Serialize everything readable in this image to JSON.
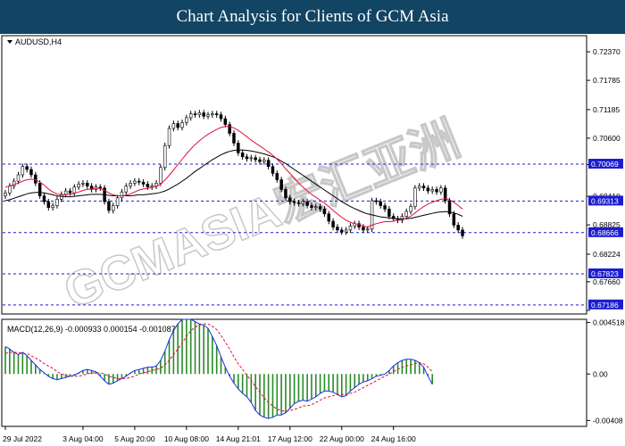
{
  "banner": {
    "title": "Chart Analysis for Clients of GCM Asia"
  },
  "chart_data": {
    "type": "candlestick",
    "symbol": "AUDUSD,H4",
    "watermark": "GCMASIA宏汇亚洲",
    "colors": {
      "bull_body": "#ffffff",
      "bear_body": "#000000",
      "wick": "#000000",
      "ma_fast": "#e0103a",
      "ma_slow": "#000000",
      "level_line": "#1c1cd0",
      "label_bg": "#1c1cd0"
    },
    "price_axis": {
      "ylim": [
        0.67,
        0.727
      ],
      "ticks": [
        0.7237,
        0.71785,
        0.71185,
        0.706,
        0.7006,
        0.6941,
        0.68825,
        0.68224,
        0.6766,
        0.67075
      ]
    },
    "levels": [
      0.70069,
      0.69313,
      0.68666,
      0.67823,
      0.67186
    ],
    "level_labels": [
      "0.70069",
      "0.69313",
      "0.68666",
      "0.67823",
      "0.67186"
    ],
    "price_ticks": [
      "0.72370",
      "0.71785",
      "0.71185",
      "0.70600",
      "0.69410",
      "0.68825",
      "0.68224",
      "0.67660"
    ],
    "close": [
      0.6948,
      0.6962,
      0.6972,
      0.6985,
      0.7002,
      0.6996,
      0.6985,
      0.6968,
      0.6942,
      0.693,
      0.6918,
      0.6922,
      0.6935,
      0.6945,
      0.6952,
      0.6948,
      0.696,
      0.6966,
      0.6968,
      0.6962,
      0.6955,
      0.696,
      0.6958,
      0.693,
      0.6912,
      0.6922,
      0.6938,
      0.695,
      0.6962,
      0.6968,
      0.6972,
      0.697,
      0.6966,
      0.696,
      0.6962,
      0.6968,
      0.7,
      0.7045,
      0.708,
      0.709,
      0.7082,
      0.7092,
      0.7102,
      0.711,
      0.7108,
      0.7112,
      0.7105,
      0.7108,
      0.711,
      0.7108,
      0.71,
      0.7088,
      0.707,
      0.705,
      0.703,
      0.7022,
      0.7018,
      0.702,
      0.7016,
      0.7012,
      0.7015,
      0.7002,
      0.6988,
      0.6975,
      0.6955,
      0.6938,
      0.693,
      0.6928,
      0.6926,
      0.693,
      0.6922,
      0.6918,
      0.692,
      0.6915,
      0.6905,
      0.689,
      0.6878,
      0.6872,
      0.6868,
      0.6872,
      0.688,
      0.6885,
      0.6878,
      0.6872,
      0.6874,
      0.6932,
      0.693,
      0.6922,
      0.6915,
      0.69,
      0.6895,
      0.6892,
      0.69,
      0.691,
      0.692,
      0.6958,
      0.6962,
      0.6958,
      0.6952,
      0.6955,
      0.695,
      0.6958,
      0.6932,
      0.6905,
      0.6882,
      0.6872,
      0.686
    ],
    "ma_fast": [
      0.696,
      0.6962,
      0.6965,
      0.6968,
      0.6972,
      0.6975,
      0.6976,
      0.6975,
      0.697,
      0.6964,
      0.6956,
      0.695,
      0.6946,
      0.6944,
      0.6944,
      0.6945,
      0.6947,
      0.695,
      0.6953,
      0.6955,
      0.6956,
      0.6957,
      0.6957,
      0.6953,
      0.6948,
      0.6944,
      0.6942,
      0.6942,
      0.6943,
      0.6946,
      0.695,
      0.6954,
      0.6956,
      0.6957,
      0.6959,
      0.6961,
      0.6966,
      0.6974,
      0.6984,
      0.6995,
      0.7006,
      0.7017,
      0.7028,
      0.7038,
      0.7047,
      0.7055,
      0.7062,
      0.7068,
      0.7073,
      0.7078,
      0.7082,
      0.7084,
      0.7084,
      0.7081,
      0.7076,
      0.707,
      0.7063,
      0.7056,
      0.705,
      0.7044,
      0.7038,
      0.7032,
      0.7025,
      0.7017,
      0.7008,
      0.6997,
      0.6988,
      0.6978,
      0.6968,
      0.696,
      0.6952,
      0.6945,
      0.6939,
      0.6933,
      0.6927,
      0.692,
      0.6912,
      0.6905,
      0.6898,
      0.6892,
      0.6888,
      0.6885,
      0.6883,
      0.688,
      0.6878,
      0.6882,
      0.6885,
      0.6887,
      0.6889,
      0.6889,
      0.689,
      0.6892,
      0.6893,
      0.6896,
      0.69,
      0.6907,
      0.6914,
      0.692,
      0.6925,
      0.6929,
      0.6932,
      0.6935,
      0.6936,
      0.6934,
      0.6929,
      0.6922,
      0.6915
    ],
    "ma_slow": [
      0.6932,
      0.6934,
      0.6937,
      0.694,
      0.6943,
      0.6946,
      0.6948,
      0.6949,
      0.6949,
      0.6948,
      0.6946,
      0.6944,
      0.6942,
      0.6941,
      0.694,
      0.694,
      0.6941,
      0.6942,
      0.6943,
      0.6944,
      0.6945,
      0.6945,
      0.6945,
      0.6944,
      0.6943,
      0.6942,
      0.6942,
      0.6942,
      0.6942,
      0.6942,
      0.6943,
      0.6944,
      0.6944,
      0.6945,
      0.6946,
      0.6947,
      0.6949,
      0.6952,
      0.6956,
      0.6961,
      0.6966,
      0.6972,
      0.6978,
      0.6985,
      0.6992,
      0.6998,
      0.7004,
      0.701,
      0.7016,
      0.7021,
      0.7026,
      0.703,
      0.7033,
      0.7035,
      0.7036,
      0.7036,
      0.7035,
      0.7034,
      0.7032,
      0.703,
      0.7028,
      0.7025,
      0.7022,
      0.7018,
      0.7013,
      0.7008,
      0.7002,
      0.6996,
      0.699,
      0.6984,
      0.6978,
      0.6972,
      0.6966,
      0.696,
      0.6954,
      0.6948,
      0.6942,
      0.6936,
      0.693,
      0.6925,
      0.692,
      0.6916,
      0.6912,
      0.6908,
      0.6905,
      0.6903,
      0.6901,
      0.6899,
      0.6898,
      0.6897,
      0.6896,
      0.6895,
      0.6895,
      0.6895,
      0.6896,
      0.6898,
      0.69,
      0.6902,
      0.6904,
      0.6906,
      0.6908,
      0.6909,
      0.691,
      0.6909,
      0.6907,
      0.6904,
      0.69
    ],
    "macd": {
      "label": "MACD(12,26,9) -0.000933 0.000154 -0.001087",
      "ylim": [
        -0.0046,
        0.0048
      ],
      "ticks": [
        "0.004518",
        "0.00",
        "-0.00408"
      ],
      "tick_values": [
        0.004518,
        0.0,
        -0.00408
      ],
      "main": [
        0.0024,
        0.0022,
        0.0019,
        0.0017,
        0.0019,
        0.0016,
        0.0012,
        0.0008,
        0.0004,
        0.0001,
        -0.0002,
        -0.0004,
        -0.0005,
        -0.0004,
        -0.0003,
        -0.0002,
        -0.0001,
        0.0001,
        0.0003,
        0.0004,
        0.0003,
        0.0002,
        -0.0002,
        -0.0006,
        -0.0009,
        -0.0008,
        -0.0006,
        -0.0004,
        -0.0002,
        0.0001,
        0.0003,
        0.0004,
        0.0005,
        0.0006,
        0.0006,
        0.0007,
        0.0012,
        0.002,
        0.003,
        0.0038,
        0.0044,
        0.0048,
        0.0048,
        0.0048,
        0.0046,
        0.0044,
        0.0043,
        0.004,
        0.0033,
        0.0025,
        0.0015,
        0.0006,
        -0.0002,
        -0.0008,
        -0.0013,
        -0.0017,
        -0.002,
        -0.0025,
        -0.0032,
        -0.0036,
        -0.0038,
        -0.0039,
        -0.0038,
        -0.0036,
        -0.0036,
        -0.0034,
        -0.003,
        -0.0026,
        -0.0024,
        -0.0023,
        -0.0024,
        -0.0022,
        -0.002,
        -0.0017,
        -0.0015,
        -0.0015,
        -0.0016,
        -0.0018,
        -0.002,
        -0.0019,
        -0.0015,
        -0.0012,
        -0.0009,
        -0.0007,
        -0.0006,
        -0.0004,
        -0.0002,
        -0.0001,
        0.0,
        0.0003,
        0.0007,
        0.001,
        0.0012,
        0.0013,
        0.0013,
        0.0012,
        0.001,
        0.0006,
        -0.0002,
        -0.0009
      ],
      "signal": [
        0.0018,
        0.0019,
        0.0019,
        0.0019,
        0.0018,
        0.0018,
        0.0016,
        0.0014,
        0.0012,
        0.0009,
        0.0007,
        0.0005,
        0.0002,
        0.0,
        -0.0001,
        -0.0002,
        -0.0002,
        -0.0002,
        -0.0001,
        0.0,
        0.0001,
        0.0001,
        0.0001,
        0.0,
        -0.0002,
        -0.0003,
        -0.0004,
        -0.0004,
        -0.0004,
        -0.0003,
        -0.0002,
        0.0,
        0.0001,
        0.0002,
        0.0003,
        0.0004,
        0.0005,
        0.0008,
        0.0012,
        0.0017,
        0.0022,
        0.0027,
        0.0033,
        0.0038,
        0.0041,
        0.0043,
        0.0044,
        0.0044,
        0.0042,
        0.0039,
        0.0034,
        0.0028,
        0.0022,
        0.0015,
        0.0009,
        0.0004,
        -0.0001,
        -0.0006,
        -0.0011,
        -0.0016,
        -0.0021,
        -0.0025,
        -0.0028,
        -0.0031,
        -0.0032,
        -0.0033,
        -0.0032,
        -0.0031,
        -0.003,
        -0.0028,
        -0.0028,
        -0.0027,
        -0.0025,
        -0.0023,
        -0.0021,
        -0.002,
        -0.0019,
        -0.0018,
        -0.0018,
        -0.0018,
        -0.0017,
        -0.0016,
        -0.0014,
        -0.0012,
        -0.001,
        -0.0008,
        -0.0006,
        -0.0004,
        -0.0002,
        0.0,
        0.0002,
        0.0004,
        0.0006,
        0.0007,
        0.0008,
        0.0009,
        0.001,
        0.0009,
        0.0006,
        0.0002
      ]
    },
    "time_axis": {
      "labels": [
        "29 Jul 2022",
        "3 Aug 04:00",
        "5 Aug 20:00",
        "10 Aug 08:00",
        "14 Aug 21:01",
        "17 Aug 12:00",
        "22 Aug 00:00",
        "24 Aug 16:00"
      ],
      "label_bar_index": [
        0,
        18,
        30,
        42,
        54,
        66,
        78,
        90
      ]
    }
  }
}
